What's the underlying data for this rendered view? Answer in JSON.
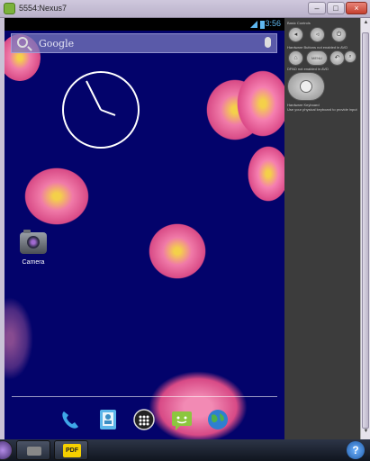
{
  "window": {
    "title": "5554:Nexus7"
  },
  "status_bar": {
    "time": "3:56"
  },
  "search": {
    "label": "Google"
  },
  "desktop": {
    "apps": [
      {
        "label": "Camera"
      }
    ]
  },
  "dock": {
    "icons": [
      "phone-icon",
      "contacts-icon",
      "all-apps-icon",
      "messaging-icon",
      "browser-icon"
    ]
  },
  "controls": {
    "basic_heading": "Basic Controls",
    "hw_buttons_heading": "Hardware Buttons not enabled in AVD",
    "dpad_heading": "DPAD not enabled in AVD",
    "keyboard_heading": "Hardware Keyboard",
    "keyboard_note": "Use your physical keyboard to provide input",
    "menu_label": "MENU"
  },
  "taskbar": {
    "pdf_label": "PDF",
    "help_label": "?"
  },
  "colors": {
    "wallpaper": "#03036b",
    "status_accent": "#5fb8f0",
    "flower": "#e86aa0"
  }
}
